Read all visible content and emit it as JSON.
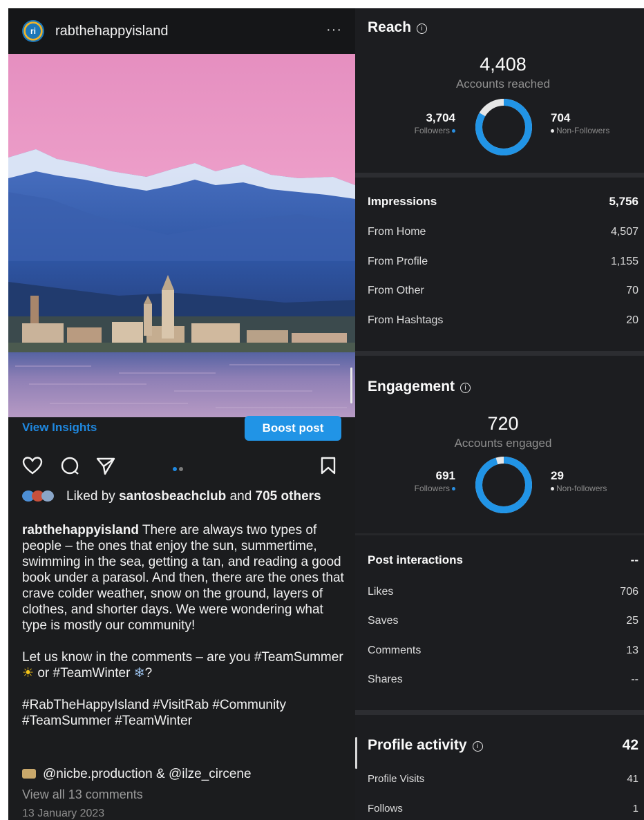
{
  "post": {
    "username": "rabthehappyisland",
    "avatar_text": "ri",
    "more": "···",
    "view_insights": "View Insights",
    "boost_post": "Boost post",
    "likes_prefix": "Liked by",
    "liked_by_user": "santosbeachclub",
    "likes_and": "and",
    "likes_others": "705 others",
    "caption_user": "rabthehappyisland",
    "caption_body": "There are always two types of people – the ones that enjoy the sun, summertime, swimming in the sea, getting a tan, and reading a good book under a parasol. And then, there are the ones that crave colder weather, snow on the ground, layers of clothes, and shorter days. We were wondering what type is mostly our community!",
    "caption_question_a": "Let us know in the comments – are you #TeamSummer",
    "caption_sun": "☀",
    "caption_question_b": "or #TeamWinter",
    "caption_snow": "❄",
    "caption_question_end": "?",
    "hashtags_line1": "#RabTheHappyIsland #VisitRab #Community",
    "hashtags_line2": "#TeamSummer #TeamWinter",
    "credits": "@nicbe.production & @ilze_circene",
    "view_comments": "View all 13 comments",
    "date": "13 January 2023",
    "carousel": {
      "count": 2,
      "active_index": 0
    },
    "icons": [
      "heart-icon",
      "comment-icon",
      "share-icon",
      "bookmark-icon",
      "camera-icon",
      "info-icon"
    ]
  },
  "insights": {
    "reach": {
      "title": "Reach",
      "total": "4,408",
      "total_label": "Accounts reached",
      "followers_value": "3,704",
      "followers_label": "Followers",
      "non_followers_value": "704",
      "non_followers_label": "Non-Followers",
      "followers_share": 0.84
    },
    "impressions": {
      "label": "Impressions",
      "value": "5,756",
      "rows": [
        {
          "label": "From Home",
          "value": "4,507"
        },
        {
          "label": "From Profile",
          "value": "1,155"
        },
        {
          "label": "From Other",
          "value": "70"
        },
        {
          "label": "From Hashtags",
          "value": "20"
        }
      ]
    },
    "engagement": {
      "title": "Engagement",
      "total": "720",
      "total_label": "Accounts engaged",
      "followers_value": "691",
      "followers_label": "Followers",
      "non_followers_value": "29",
      "non_followers_label": "Non-followers",
      "followers_share": 0.96
    },
    "post_interactions": {
      "label": "Post interactions",
      "value": "--",
      "rows": [
        {
          "label": "Likes",
          "value": "706"
        },
        {
          "label": "Saves",
          "value": "25"
        },
        {
          "label": "Comments",
          "value": "13"
        },
        {
          "label": "Shares",
          "value": "--"
        }
      ]
    },
    "profile_activity": {
      "title": "Profile activity",
      "value": "42",
      "rows": [
        {
          "label": "Profile Visits",
          "value": "41"
        },
        {
          "label": "Follows",
          "value": "1"
        }
      ]
    }
  },
  "colors": {
    "accent_blue": "#2194e6",
    "link_blue": "#1f88e0",
    "panel_bg": "#1c1d20",
    "donut_remainder": "#e6e6e6"
  }
}
